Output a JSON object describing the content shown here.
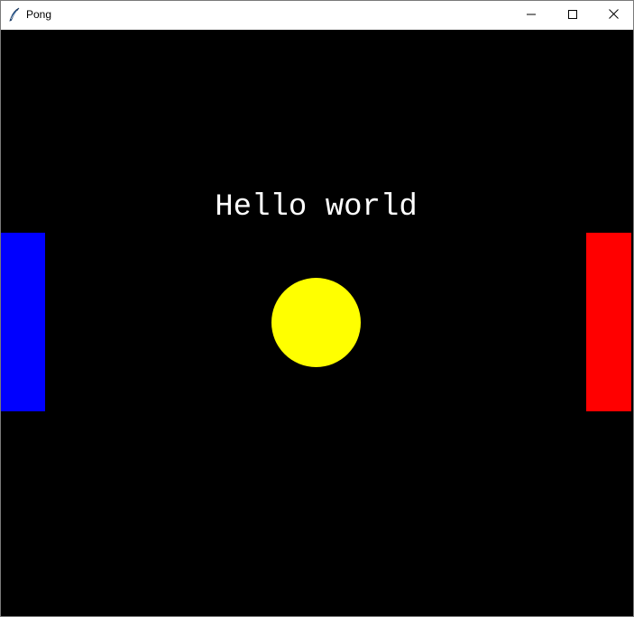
{
  "window": {
    "title": "Pong",
    "controls": {
      "minimize_icon": "minimize-icon",
      "maximize_icon": "maximize-icon",
      "close_icon": "close-icon"
    }
  },
  "game": {
    "background_color": "#000000",
    "text": "Hello world",
    "text_color": "#ffffff",
    "left_paddle_color": "#0000ff",
    "right_paddle_color": "#ff0000",
    "ball_color": "#ffff00"
  }
}
